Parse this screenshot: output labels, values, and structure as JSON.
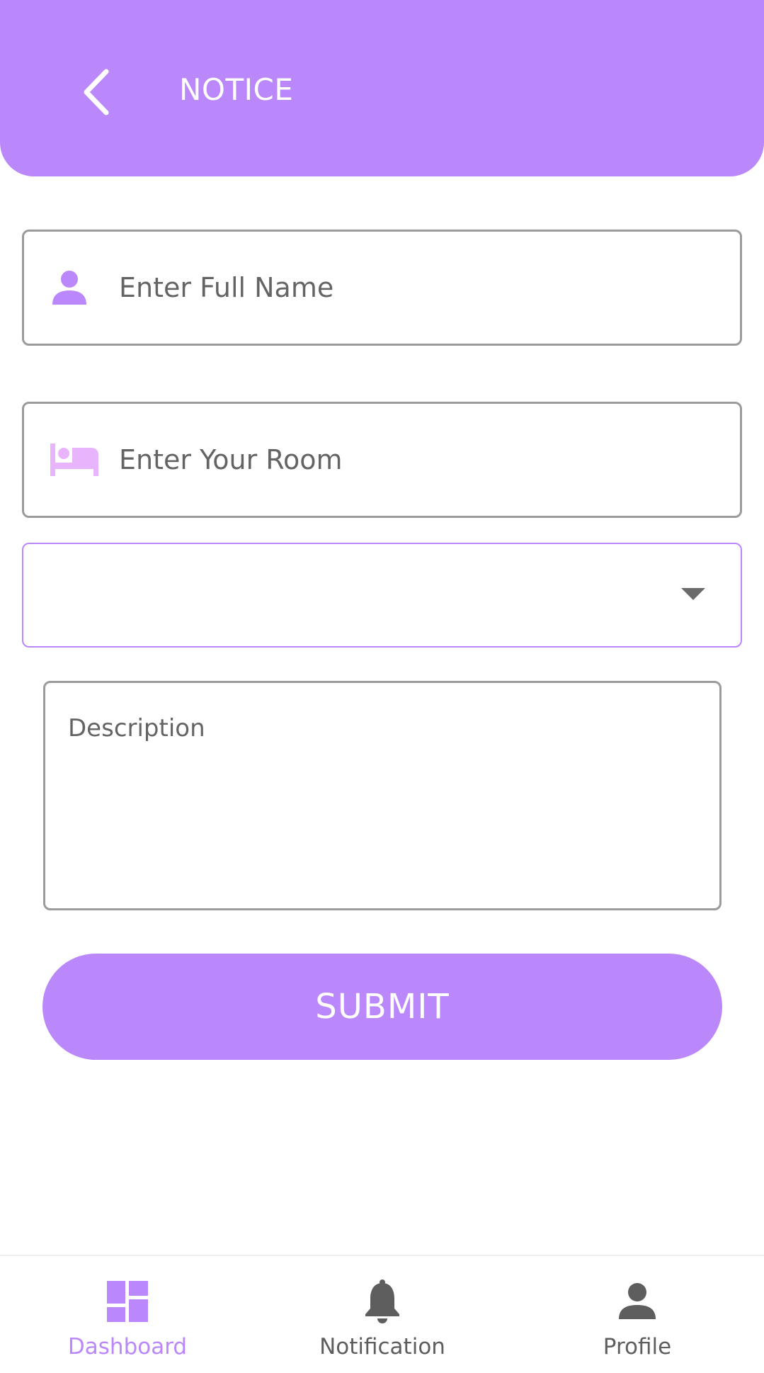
{
  "colors": {
    "accent": "#bb88fb",
    "bed_icon": "#e8b4fb",
    "border": "#9b9b9b",
    "text": "#5e5e5e",
    "nav_inactive": "#5e5e5e"
  },
  "header": {
    "back_icon": "chevron-left-icon",
    "title": "NOTICE"
  },
  "form": {
    "name_field": {
      "icon": "person-icon",
      "placeholder": "Enter Full Name",
      "value": ""
    },
    "room_field": {
      "icon": "bed-icon",
      "placeholder": "Enter Your Room",
      "value": ""
    },
    "type_select": {
      "selected": "",
      "icon": "dropdown-arrow-icon"
    },
    "description": {
      "placeholder": "Description",
      "value": ""
    },
    "submit_label": "SUBMIT"
  },
  "bottom_nav": {
    "items": [
      {
        "label": "Dashboard",
        "icon": "dashboard-icon",
        "active": true
      },
      {
        "label": "Notification",
        "icon": "bell-icon",
        "active": false
      },
      {
        "label": "Profile",
        "icon": "person-icon",
        "active": false
      }
    ]
  }
}
